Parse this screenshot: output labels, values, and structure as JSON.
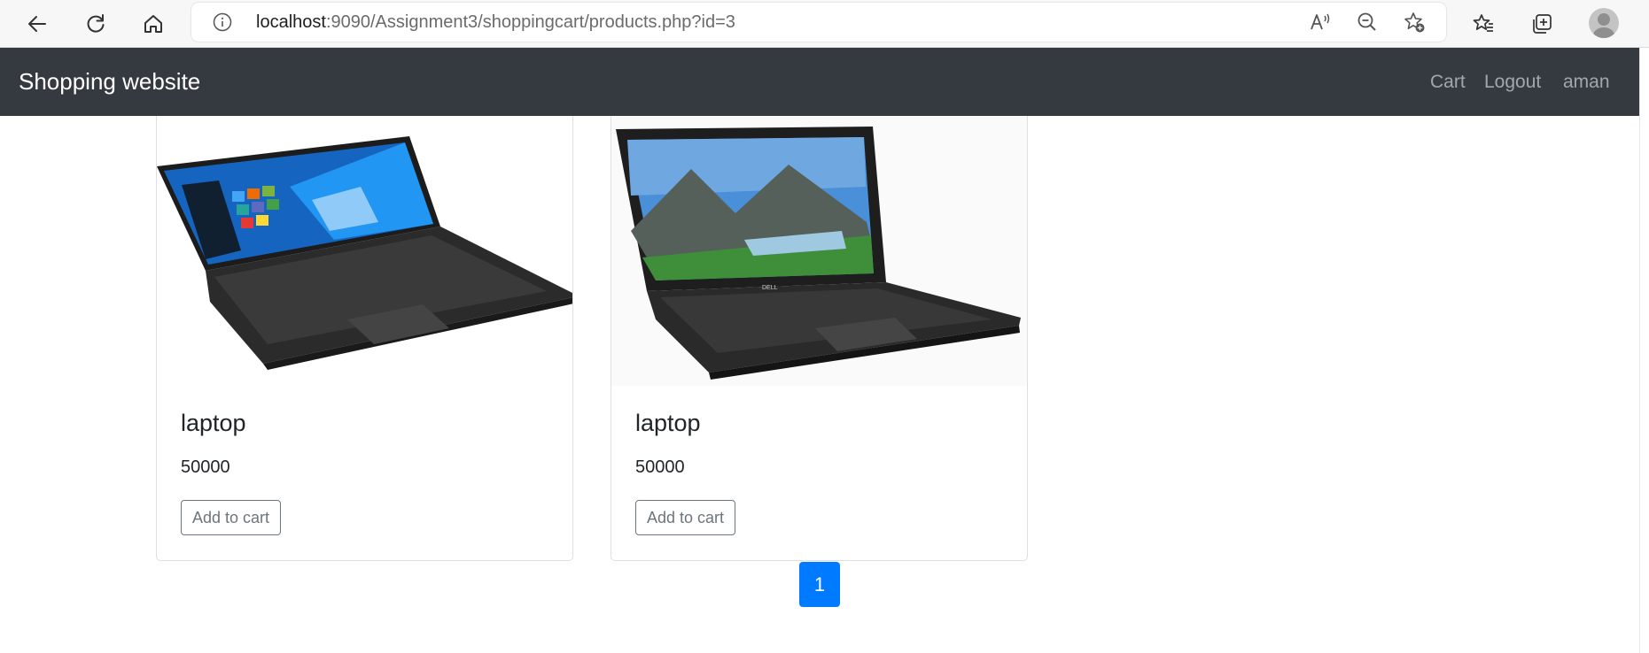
{
  "browser": {
    "url_host": "localhost",
    "url_rest": ":9090/Assignment3/shoppingcart/products.php?id=3",
    "icons": [
      "back-icon",
      "refresh-icon",
      "home-icon",
      "info-icon",
      "read-aloud-icon",
      "zoom-out-icon",
      "add-favorite-icon",
      "favorites-icon",
      "collections-icon",
      "profile-avatar"
    ]
  },
  "navbar": {
    "brand": "Shopping website",
    "links": [
      "Cart",
      "Logout",
      "aman"
    ],
    "background": "#343a40"
  },
  "products": [
    {
      "name": "laptop",
      "price": "50000",
      "button": "Add to cart",
      "image": "asus-laptop-image"
    },
    {
      "name": "laptop",
      "price": "50000",
      "button": "Add to cart",
      "image": "dell-laptop-image"
    }
  ],
  "pagination": {
    "current_page": "1",
    "accent": "#007bff"
  }
}
